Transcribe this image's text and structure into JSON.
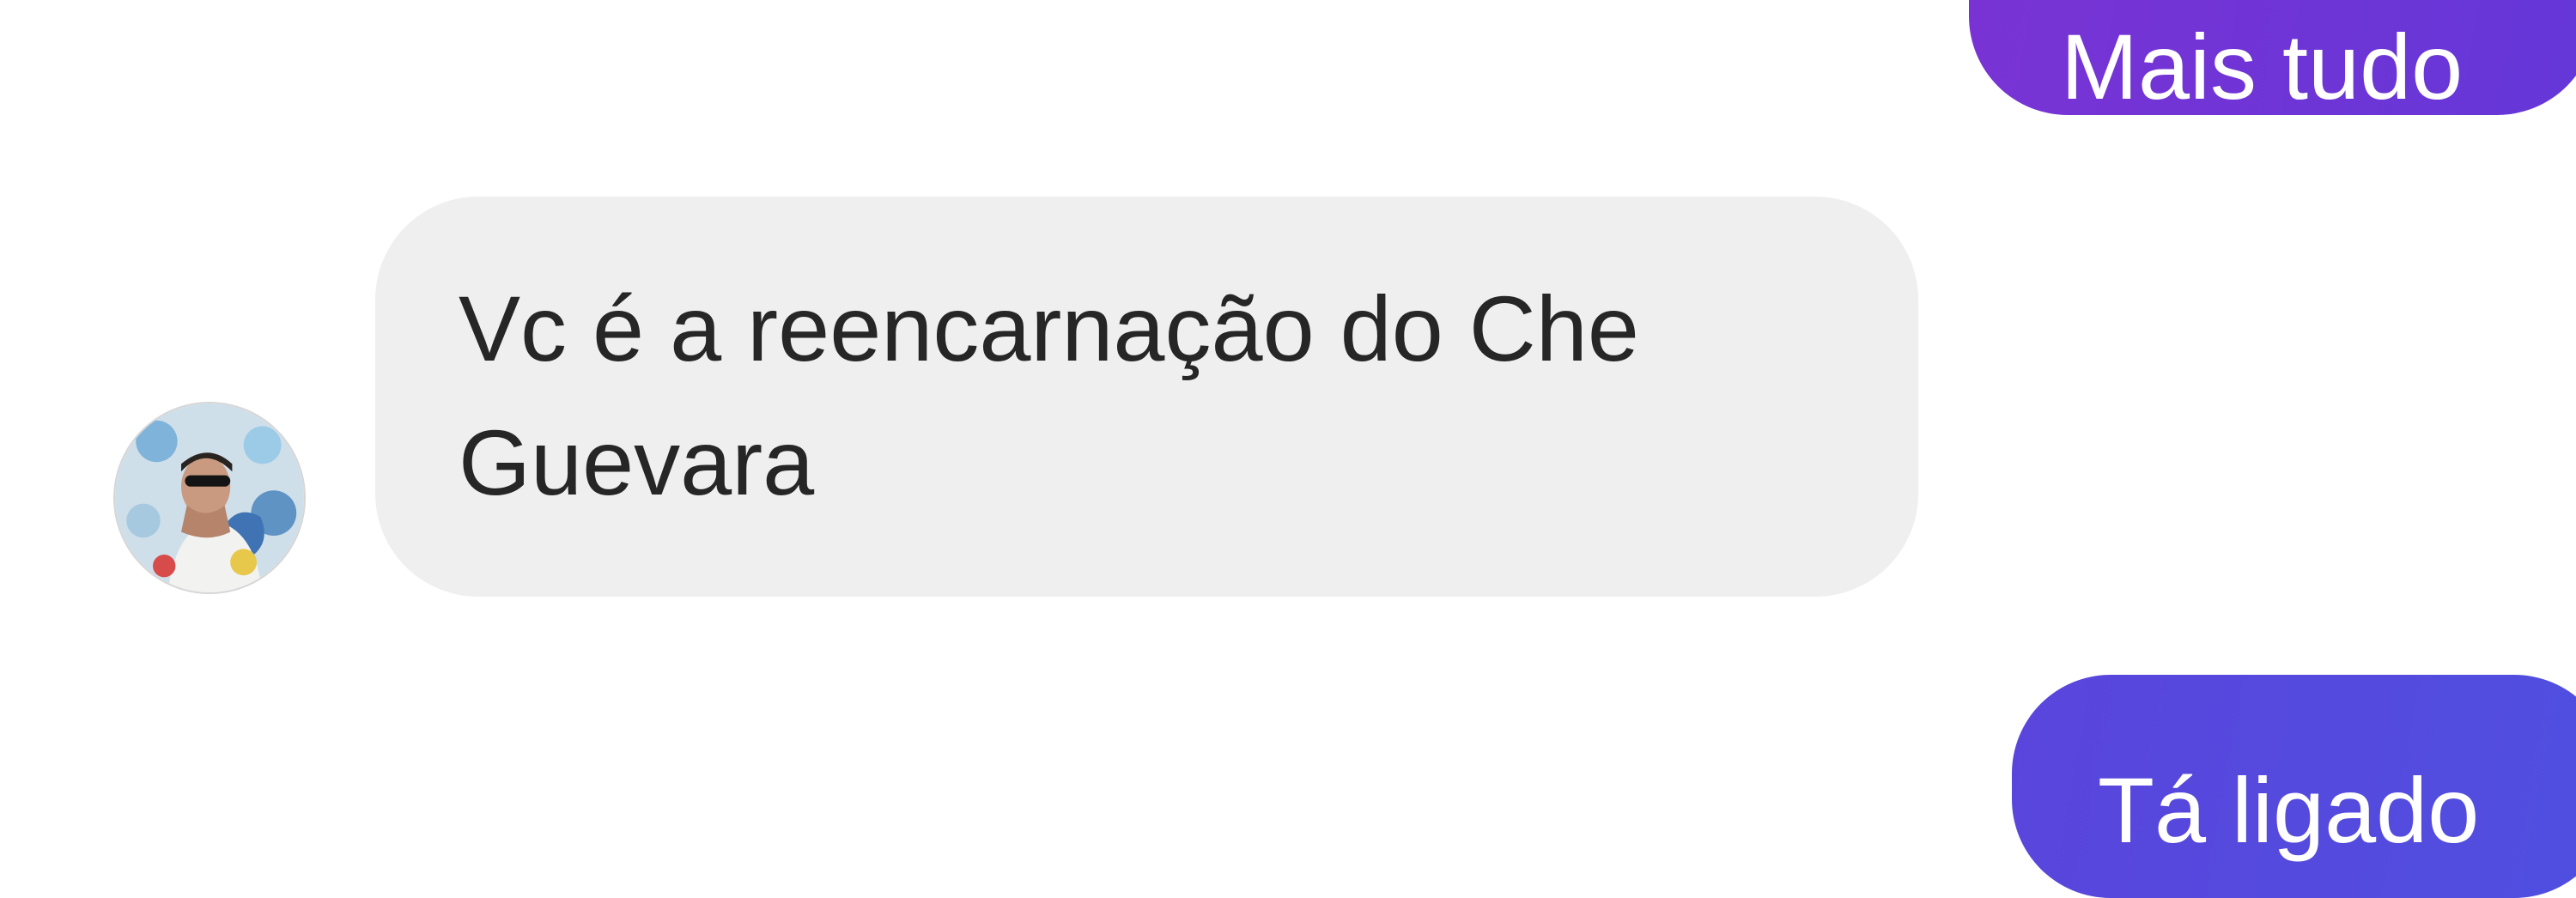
{
  "thread": {
    "messages": [
      {
        "sender": "me",
        "text": "Mais tudo"
      },
      {
        "sender": "contact",
        "lines": [
          "Vc é a reencarnação do Che",
          "Guevara"
        ]
      },
      {
        "sender": "me",
        "text": "Tá ligado"
      }
    ]
  },
  "contact": {
    "avatar_icon": "profile-photo-avatar"
  },
  "colors": {
    "sent_bubble_top": "#7a33d4",
    "sent_bubble_bottom": "#5a45dc",
    "received_bubble": "#efefef",
    "received_text": "#262626",
    "sent_text": "#ffffff"
  }
}
